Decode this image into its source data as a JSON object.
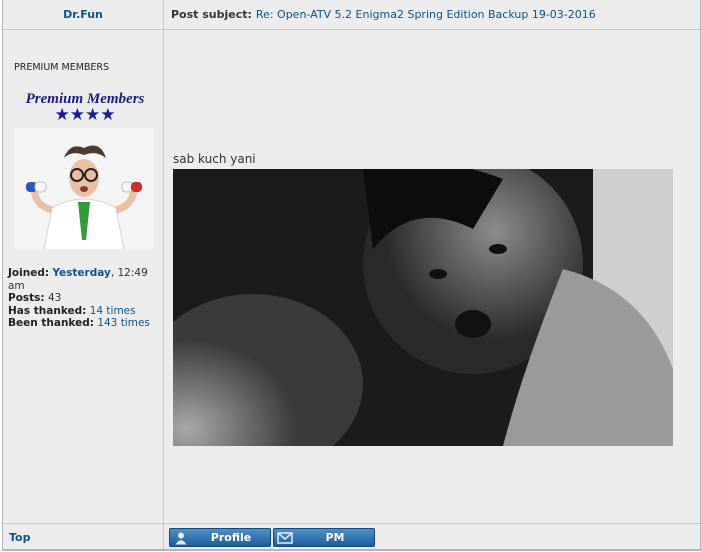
{
  "post": {
    "author": "Dr.Fun",
    "subject_label": "Post subject:",
    "subject": "Re: Open-ATV 5.2 Enigma2 Spring Edition Backup 19-03-2016",
    "body_text": "sab kuch yani"
  },
  "author_profile": {
    "rank_text": "PREMIUM MEMBERS",
    "rank_badge_text": "Premium Members",
    "rank_stars": "★★★★",
    "joined_label": "Joined:",
    "joined_value": "Yesterday",
    "joined_time": ", 12:49",
    "joined_ampm": "am",
    "posts_label": "Posts:",
    "posts_value": "43",
    "has_thanked_label": "Has thanked:",
    "has_thanked_value": "14 times",
    "been_thanked_label": "Been thanked:",
    "been_thanked_value": "143 times"
  },
  "footer": {
    "top_label": "Top",
    "profile_button": "Profile",
    "pm_button": "PM"
  },
  "colors": {
    "link": "#105289",
    "button": "#2b6ca8",
    "background": "#ececec"
  }
}
